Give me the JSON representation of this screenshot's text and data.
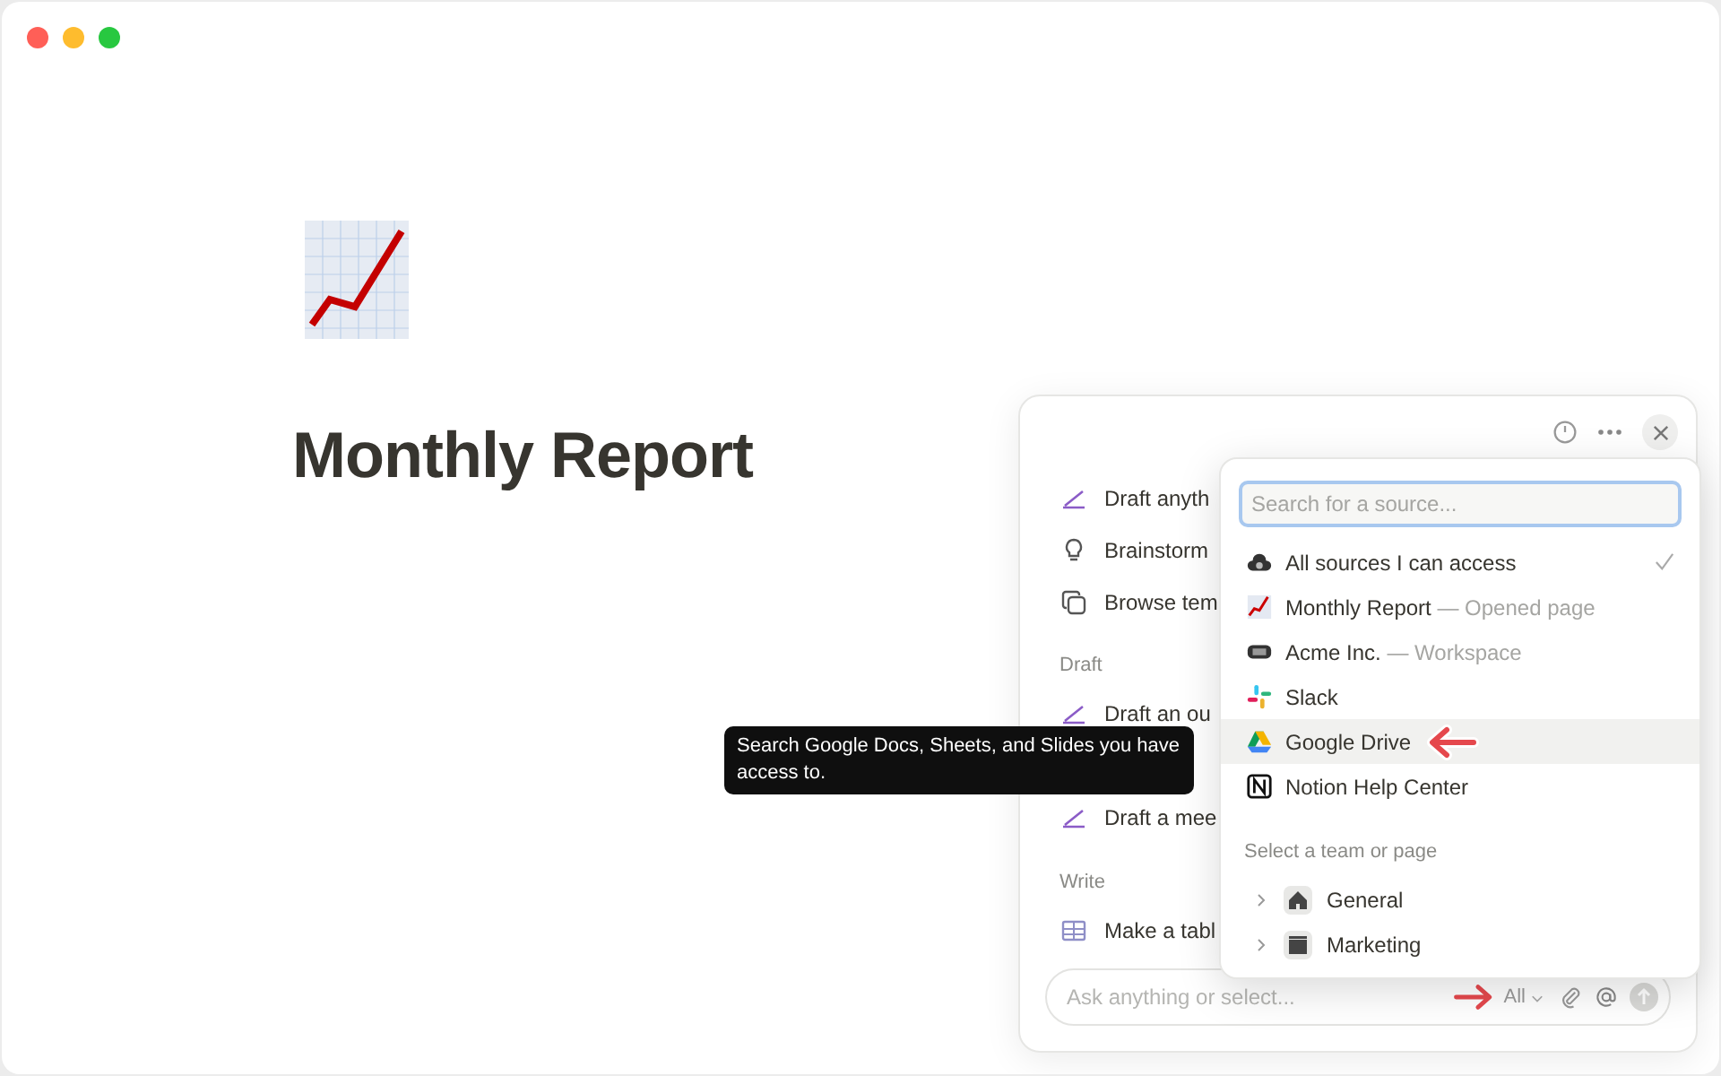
{
  "page": {
    "title": "Monthly Report"
  },
  "assistant": {
    "groups": [
      {
        "items": [
          {
            "label": "Draft anyth"
          },
          {
            "label": "Brainstorm"
          },
          {
            "label": "Browse tem"
          }
        ]
      },
      {
        "heading": "Draft",
        "items": [
          {
            "label": "Draft an ou"
          },
          {
            "label": "Draft a mee"
          }
        ]
      },
      {
        "heading": "Write",
        "items": [
          {
            "label": "Make a tabl"
          }
        ]
      }
    ],
    "composer": {
      "placeholder": "Ask anything or select...",
      "scope": "All"
    }
  },
  "source_menu": {
    "placeholder": "Search for a source...",
    "sources": [
      {
        "label": "All sources I can access",
        "selected": true,
        "highlighted": false
      },
      {
        "label": "Monthly Report",
        "note": "— Opened page",
        "selected": false,
        "highlighted": false
      },
      {
        "label": "Acme Inc.",
        "note": "— Workspace",
        "selected": false,
        "highlighted": false
      },
      {
        "label": "Slack",
        "selected": false,
        "highlighted": false
      },
      {
        "label": "Google Drive",
        "selected": false,
        "highlighted": true
      },
      {
        "label": "Notion Help Center",
        "selected": false,
        "highlighted": false
      }
    ],
    "heading": "Select a team or page",
    "teams": [
      {
        "label": "General",
        "expanded": false
      },
      {
        "label": "Marketing",
        "expanded": false
      }
    ]
  },
  "tooltip": {
    "text": "Search Google Docs, Sheets, and Slides you have access to."
  }
}
